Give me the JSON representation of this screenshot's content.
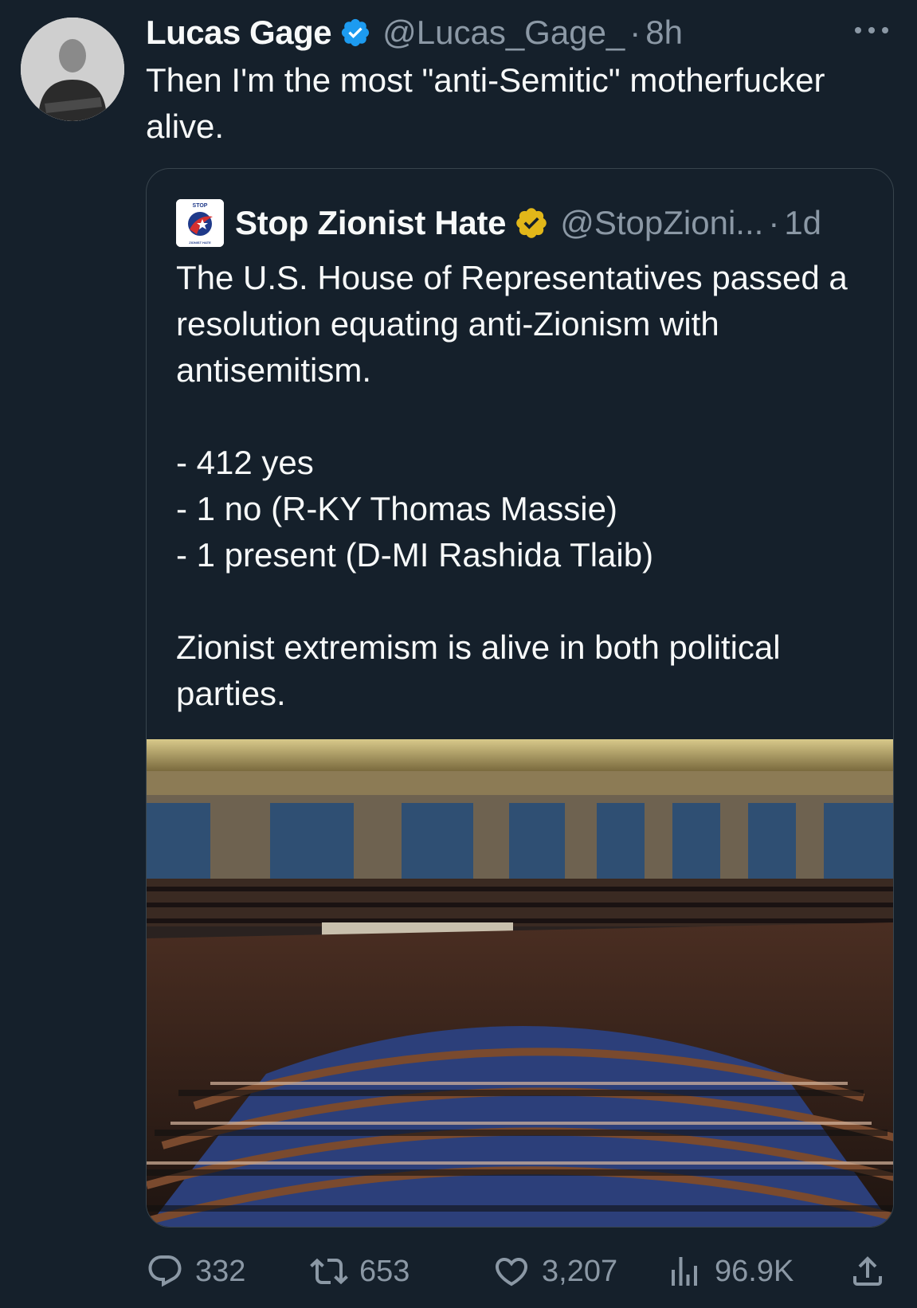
{
  "tweet": {
    "author_name": "Lucas Gage",
    "author_handle": "@Lucas_Gage_",
    "separator": "·",
    "time": "8h",
    "text": "Then I'm the most \"anti-Semitic\" motherfucker alive."
  },
  "quoted": {
    "author_name": "Stop Zionist Hate",
    "author_handle": "@StopZioni...",
    "separator": "·",
    "time": "1d",
    "logo_text_top": "STOP",
    "logo_text_bottom": "ZIONIST HATE",
    "text": "The U.S. House of Representatives passed a resolution equating anti-Zionism with antisemitism.\n\n- 412 yes\n- 1 no (R-KY Thomas Massie)\n- 1 present (D-MI Rashida Tlaib)\n\nZionist extremism is alive in both political parties."
  },
  "actions": {
    "replies": "332",
    "reposts": "653",
    "likes": "3,207",
    "views": "96.9K"
  },
  "colors": {
    "background": "#15202b",
    "text": "#f7f9f9",
    "muted": "#8b98a5",
    "verified_blue": "#1d9bf0",
    "verified_gold": "#e2b719",
    "border": "#38444d"
  },
  "icons": {
    "verified": "verified-badge-icon",
    "more": "more-icon",
    "reply": "reply-icon",
    "repost": "repost-icon",
    "like": "like-icon",
    "views": "views-icon",
    "share": "share-icon"
  }
}
